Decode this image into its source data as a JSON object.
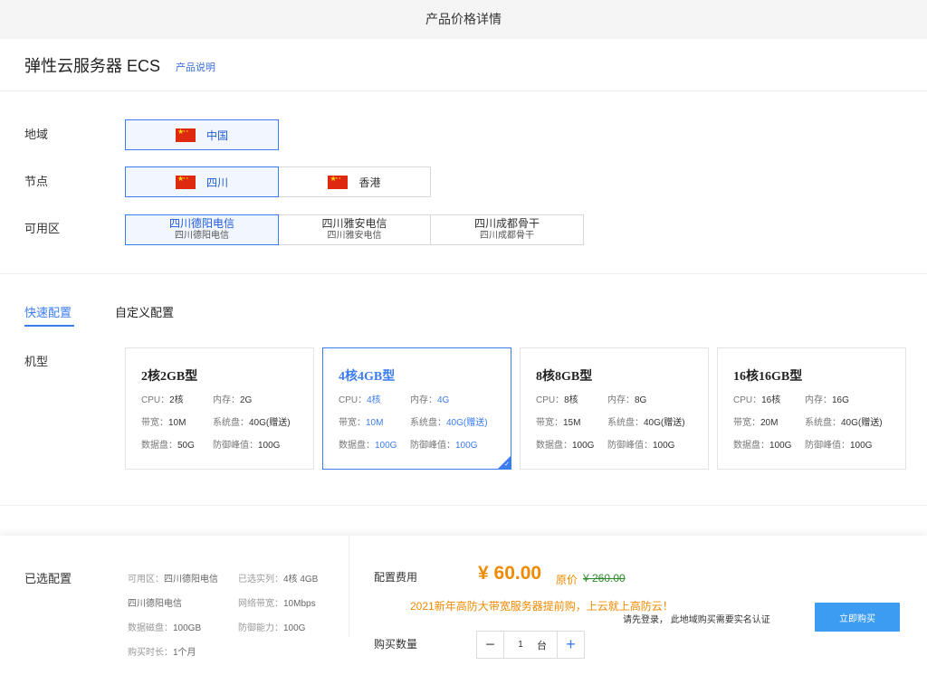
{
  "topbar": {
    "title": "产品价格详情"
  },
  "header": {
    "title": "弹性云服务器 ECS",
    "desc_link": "产品说明"
  },
  "region": {
    "label": "地域",
    "options": [
      "中国"
    ]
  },
  "node": {
    "label": "节点",
    "options": [
      "四川",
      "香港"
    ]
  },
  "zone": {
    "label": "可用区",
    "options": [
      {
        "title": "四川德阳电信",
        "sub": "四川德阳电信"
      },
      {
        "title": "四川雅安电信",
        "sub": "四川雅安电信"
      },
      {
        "title": "四川成都骨干",
        "sub": "四川成都骨干"
      }
    ]
  },
  "tabs": [
    "快速配置",
    "自定义配置"
  ],
  "model": {
    "label": "机型",
    "cards": [
      {
        "name": "2核2GB型",
        "cpu_l": "CPU：",
        "cpu": "2核",
        "mem_l": "内存：",
        "mem": "2G",
        "bw_l": "带宽：",
        "bw": "10M",
        "sys_l": "系统盘：",
        "sys": "40G(赠送)",
        "data_l": "数据盘：",
        "data": "50G",
        "def_l": "防御峰值：",
        "def": "100G"
      },
      {
        "name": "4核4GB型",
        "cpu_l": "CPU：",
        "cpu": "4核",
        "mem_l": "内存：",
        "mem": "4G",
        "bw_l": "带宽：",
        "bw": "10M",
        "sys_l": "系统盘：",
        "sys": "40G(赠送)",
        "data_l": "数据盘：",
        "data": "100G",
        "def_l": "防御峰值：",
        "def": "100G"
      },
      {
        "name": "8核8GB型",
        "cpu_l": "CPU：",
        "cpu": "8核",
        "mem_l": "内存：",
        "mem": "8G",
        "bw_l": "带宽：",
        "bw": "15M",
        "sys_l": "系统盘：",
        "sys": "40G(赠送)",
        "data_l": "数据盘：",
        "data": "100G",
        "def_l": "防御峰值：",
        "def": "100G"
      },
      {
        "name": "16核16GB型",
        "cpu_l": "CPU：",
        "cpu": "16核",
        "mem_l": "内存：",
        "mem": "16G",
        "bw_l": "带宽：",
        "bw": "20M",
        "sys_l": "系统盘：",
        "sys": "40G(赠送)",
        "data_l": "数据盘：",
        "data": "100G",
        "def_l": "防御峰值：",
        "def": "100G"
      }
    ]
  },
  "summary": {
    "label": "已选配置",
    "zone_l": "可用区：",
    "zone": "四川德阳电信",
    "inst_l": "已选实列：",
    "inst": "4核 4GB",
    "zone_line2": "四川德阳电信",
    "net_l": "网络带宽：",
    "net": "10Mbps",
    "disk_l": "数据磁盘：",
    "disk": "100GB",
    "def_l": "防御能力：",
    "def": "100G",
    "dur_l": "购买时长：",
    "dur": "1个月"
  },
  "pricing": {
    "fee_label": "配置费用",
    "price": "¥ 60.00",
    "orig_label": "原价",
    "orig_value": "¥ 260.00",
    "promo": "2021新年高防大带宽服务器提前购，上云就上高防云！",
    "notice": "请先登录， 此地域购买需要实名认证",
    "buy": "立即购买",
    "qty_label": "购买数量",
    "qty": "1",
    "unit": "台"
  },
  "colors": {
    "accent": "#3b7cf0",
    "price": "#f08a00",
    "buy_button": "#3b9cf2",
    "orig_price": "#2e8b2e"
  }
}
